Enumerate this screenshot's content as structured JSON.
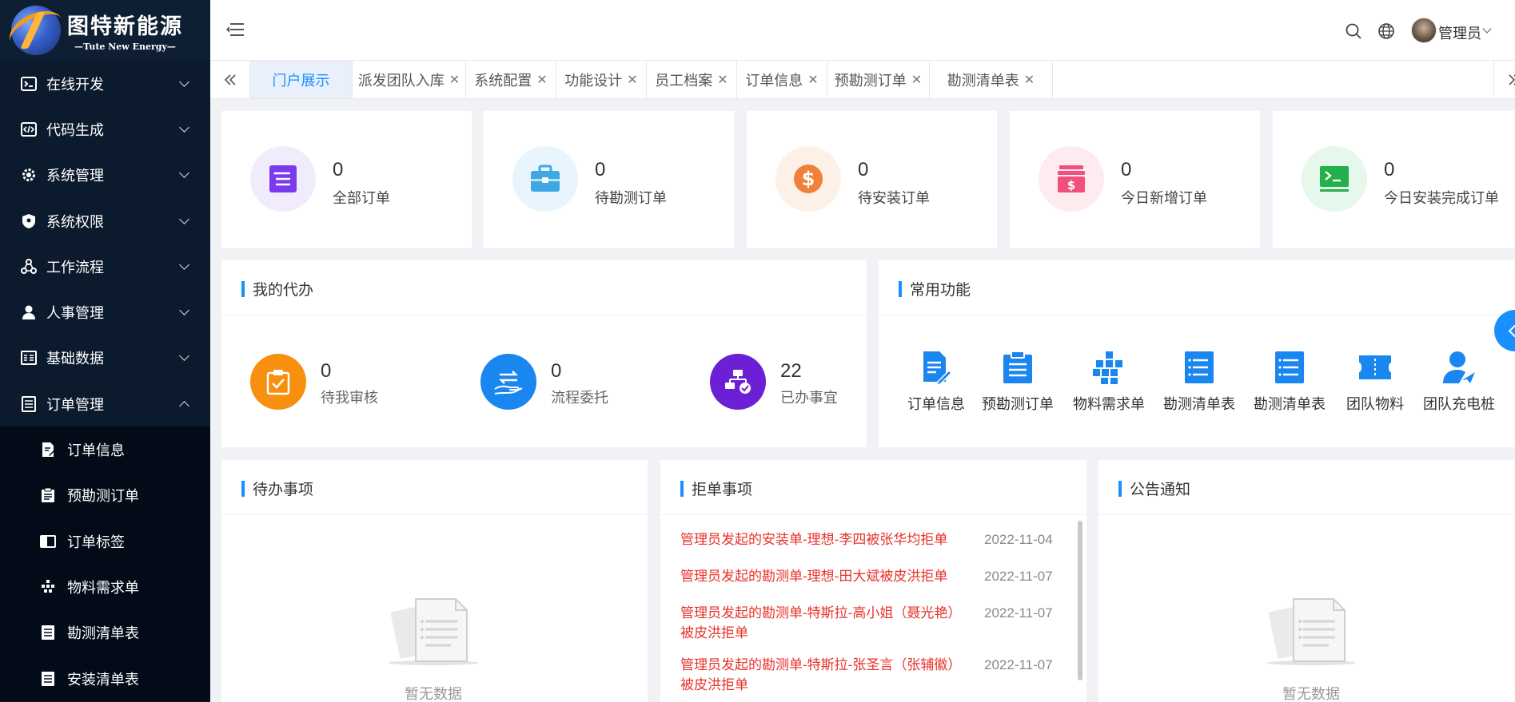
{
  "app": {
    "logo_cn": "图特新能源",
    "logo_en": "—Tute New Energy—"
  },
  "sidebar": {
    "items": [
      {
        "label": "在线开发",
        "icon": "terminal-icon"
      },
      {
        "label": "代码生成",
        "icon": "code-icon"
      },
      {
        "label": "系统管理",
        "icon": "gear-icon"
      },
      {
        "label": "系统权限",
        "icon": "shield-icon"
      },
      {
        "label": "工作流程",
        "icon": "workflow-icon"
      },
      {
        "label": "人事管理",
        "icon": "person-icon"
      },
      {
        "label": "基础数据",
        "icon": "data-icon"
      },
      {
        "label": "订单管理",
        "icon": "list-icon",
        "expanded": true
      }
    ],
    "subitems": [
      {
        "label": "订单信息",
        "icon": "doc-edit-icon"
      },
      {
        "label": "预勘测订单",
        "icon": "clipboard-icon"
      },
      {
        "label": "订单标签",
        "icon": "tag-icon"
      },
      {
        "label": "物料需求单",
        "icon": "blocks-icon"
      },
      {
        "label": "勘测清单表",
        "icon": "list-icon"
      },
      {
        "label": "安装清单表",
        "icon": "list-icon"
      }
    ]
  },
  "header": {
    "user_name": "管理员"
  },
  "tabs": [
    {
      "label": "门户展示",
      "active": true,
      "closable": false
    },
    {
      "label": "派发团队入库",
      "closable": true
    },
    {
      "label": "系统配置",
      "closable": true
    },
    {
      "label": "功能设计",
      "closable": true
    },
    {
      "label": "员工档案",
      "closable": true
    },
    {
      "label": "订单信息",
      "closable": true
    },
    {
      "label": "预勘测订单",
      "closable": true
    },
    {
      "label": "勘测清单表",
      "closable": true
    }
  ],
  "stats": [
    {
      "value": "0",
      "label": "全部订单",
      "color": "#7c3aed",
      "bg": "#f1ecfb"
    },
    {
      "value": "0",
      "label": "待勘测订单",
      "color": "#3ea7e6",
      "bg": "#e8f5fc"
    },
    {
      "value": "0",
      "label": "待安装订单",
      "color": "#f0803a",
      "bg": "#fdf0e6"
    },
    {
      "value": "0",
      "label": "今日新增订单",
      "color": "#f0507a",
      "bg": "#fdebf0"
    },
    {
      "value": "0",
      "label": "今日安装完成订单",
      "color": "#22b14c",
      "bg": "#e6f7ec"
    }
  ],
  "my_todo": {
    "title": "我的代办",
    "items": [
      {
        "value": "0",
        "label": "待我审核",
        "color": "#f7900f"
      },
      {
        "value": "0",
        "label": "流程委托",
        "color": "#1a86f0"
      },
      {
        "value": "22",
        "label": "已办事宜",
        "color": "#6d1fd6"
      }
    ]
  },
  "common_functions": {
    "title": "常用功能",
    "items": [
      {
        "label": "订单信息",
        "icon": "doc-edit-icon"
      },
      {
        "label": "预勘测订单",
        "icon": "clipboard-icon"
      },
      {
        "label": "物料需求单",
        "icon": "blocks-icon"
      },
      {
        "label": "勘测清单表",
        "icon": "list-icon"
      },
      {
        "label": "勘测清单表",
        "icon": "list-icon"
      },
      {
        "label": "团队物料",
        "icon": "ticket-icon"
      },
      {
        "label": "团队充电桩",
        "icon": "person-send-icon"
      }
    ],
    "color": "#1a86f0"
  },
  "pending": {
    "title": "待办事项",
    "empty": "暂无数据"
  },
  "rejected": {
    "title": "拒单事项",
    "rows": [
      {
        "text": "管理员发起的安装单-理想-李四被张华均拒单",
        "date": "2022-11-04"
      },
      {
        "text": "管理员发起的勘测单-理想-田大斌被皮洪拒单",
        "date": "2022-11-07"
      },
      {
        "text": "管理员发起的勘测单-特斯拉-高小姐（聂光艳）被皮洪拒单",
        "date": "2022-11-07"
      },
      {
        "text": "管理员发起的勘测单-特斯拉-张圣言（张辅徽）被皮洪拒单",
        "date": "2022-11-07"
      }
    ]
  },
  "notice": {
    "title": "公告通知",
    "empty": "暂无数据"
  }
}
